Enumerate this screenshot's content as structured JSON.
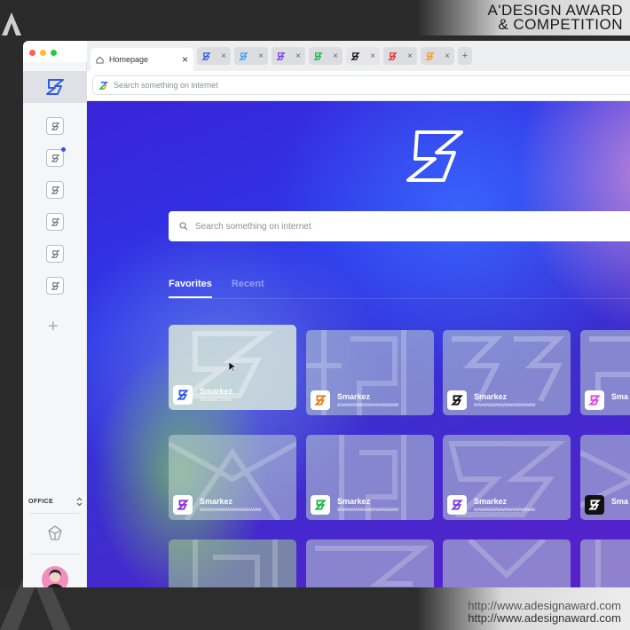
{
  "watermark": {
    "award_line1": "A'DESIGN AWARD",
    "award_line2": "& COMPETITION",
    "url_line1": "http://www.adesignaward.com",
    "url_line2": "http://www.adesignaward.com"
  },
  "browser": {
    "tabs": {
      "home_label": "Homepage",
      "close": "×",
      "add": "+",
      "others": [
        {
          "icon": "blue-z-logo-icon",
          "color": "#2f5be8"
        },
        {
          "icon": "lightblue-z-logo-icon",
          "color": "#3a9ef0"
        },
        {
          "icon": "purple-z-logo-icon",
          "color": "#7a3ee6"
        },
        {
          "icon": "green-z-logo-icon",
          "color": "#19b84a"
        },
        {
          "icon": "black-z-logo-icon",
          "color": "#111111"
        },
        {
          "icon": "red-z-logo-icon",
          "color": "#e52e2e"
        },
        {
          "icon": "orange-z-logo-icon",
          "color": "#f59a23"
        }
      ]
    },
    "address_placeholder": "Search something on internet"
  },
  "sidebar": {
    "workspace_label": "OFFICE",
    "add": "+"
  },
  "main": {
    "search_placeholder": "Search something on internet",
    "tabs": [
      {
        "label": "Favorites"
      },
      {
        "label": "Recent"
      }
    ],
    "cards": [
      {
        "title": "Smarkez",
        "url": "smarkez.com",
        "icon_color": "#2f5be8"
      },
      {
        "title": "Smarkez",
        "url": "wwwwwwwwwwwwwwww",
        "icon_color": "#f07a1a"
      },
      {
        "title": "Smarkez",
        "url": "wwwwwwwwwwwwwwww",
        "icon_color": "#111111"
      },
      {
        "title": "Sma",
        "url": "",
        "icon_color": "#e24ad8"
      },
      {
        "title": "Smarkez",
        "url": "wwwwwwwwwwwwwwww",
        "icon_color": "#8b2ee0"
      },
      {
        "title": "Smarkez",
        "url": "wwwwwwwwwwwwwwww",
        "icon_color": "#19b84a"
      },
      {
        "title": "Smarkez",
        "url": "wwwwwwwwwwwwwwww",
        "icon_color": "#7a3ee6"
      },
      {
        "title": "Sma",
        "url": "",
        "icon_color": "#111111"
      }
    ]
  }
}
